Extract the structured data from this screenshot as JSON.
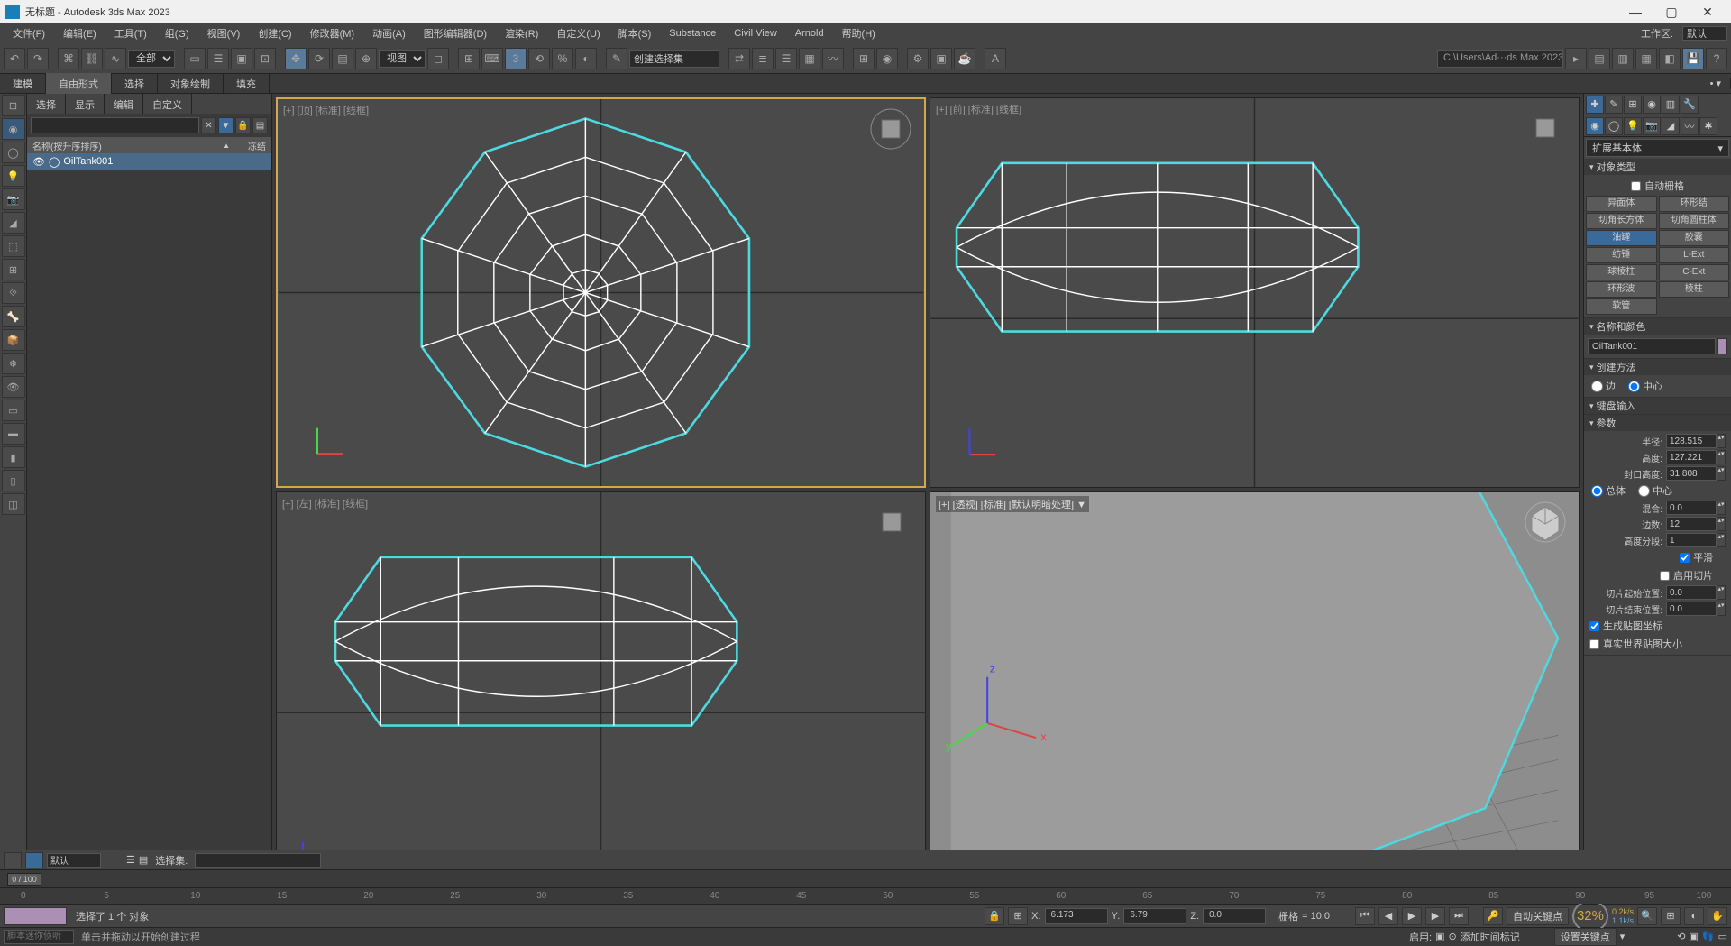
{
  "title": "无标题 - Autodesk 3ds Max 2023",
  "menu": [
    "文件(F)",
    "编辑(E)",
    "工具(T)",
    "组(G)",
    "视图(V)",
    "创建(C)",
    "修改器(M)",
    "动画(A)",
    "图形编辑器(D)",
    "渲染(R)",
    "自定义(U)",
    "脚本(S)",
    "Substance",
    "Civil View",
    "Arnold",
    "帮助(H)"
  ],
  "workspace_label": "工作区:",
  "workspace_value": "默认",
  "path": "C:\\Users\\Ad···ds Max 2023",
  "tb_view": "视图",
  "tb_select_set": "创建选择集",
  "tb_all": "全部",
  "ribbon": {
    "tabs": [
      "建模",
      "自由形式",
      "选择",
      "对象绘制",
      "填充"
    ],
    "active": 1
  },
  "explorer": {
    "tabs": [
      "选择",
      "显示",
      "编辑",
      "自定义"
    ],
    "col_name": "名称(按升序排序)",
    "col_frozen": "冻结",
    "item": "OilTank001"
  },
  "vp": {
    "top": "[+] [顶] [标准] [线框]",
    "front": "[+] [前] [标准] [线框]",
    "left": "[+] [左] [标准] [线框]",
    "persp": "[+] [透视] [标准] [默认明暗处理] ▼"
  },
  "cmd": {
    "category": "扩展基本体",
    "object_type": "对象类型",
    "auto_grid": "自动栅格",
    "buttons": [
      [
        "异面体",
        "环形结"
      ],
      [
        "切角长方体",
        "切角圆柱体"
      ],
      [
        "油罐",
        "胶囊"
      ],
      [
        "纺锤",
        "L-Ext"
      ],
      [
        "球棱柱",
        "C-Ext"
      ],
      [
        "环形波",
        "棱柱"
      ],
      [
        "软管",
        ""
      ]
    ],
    "active_btn": "油罐",
    "name_color": "名称和颜色",
    "object_name": "OilTank001",
    "create_method": "创建方法",
    "edge": "边",
    "center": "中心",
    "keyboard": "键盘输入",
    "params": "参数",
    "radius_l": "半径:",
    "radius_v": "128.515",
    "height_l": "高度:",
    "height_v": "127.221",
    "cap_l": "封口高度:",
    "cap_v": "31.808",
    "overall": "总体",
    "centers": "中心",
    "blend_l": "混合:",
    "blend_v": "0.0",
    "sides_l": "边数:",
    "sides_v": "12",
    "hseg_l": "高度分段:",
    "hseg_v": "1",
    "smooth": "平滑",
    "slice_on": "启用切片",
    "slice_from_l": "切片起始位置:",
    "slice_from_v": "0.0",
    "slice_to_l": "切片结束位置:",
    "slice_to_v": "0.0",
    "gen_uv": "生成贴图坐标",
    "real_uv": "真实世界贴图大小"
  },
  "time": {
    "default": "默认",
    "sel_set": "选择集:",
    "frame": "0 / 100",
    "ticks": [
      0,
      5,
      10,
      15,
      20,
      25,
      30,
      35,
      40,
      45,
      50,
      55,
      60,
      65,
      70,
      75,
      80,
      85,
      90,
      95,
      100
    ]
  },
  "status": {
    "line1": "选择了 1 个 对象",
    "line2": "单击并拖动以开始创建过程",
    "x_l": "X:",
    "x_v": "6.173",
    "y_l": "Y:",
    "y_v": "6.79",
    "z_l": "Z:",
    "z_v": "0.0",
    "grid_l": "栅格",
    "grid_v": "= 10.0",
    "auto_key": "自动关键点",
    "set_key": "设置关键点",
    "enable": "启用:",
    "add_marker": "添加时间标记",
    "script_ph": "脚本迷你侦听",
    "pct": "32%",
    "fps1": "0.2k/s",
    "fps2": "1.1k/s"
  }
}
